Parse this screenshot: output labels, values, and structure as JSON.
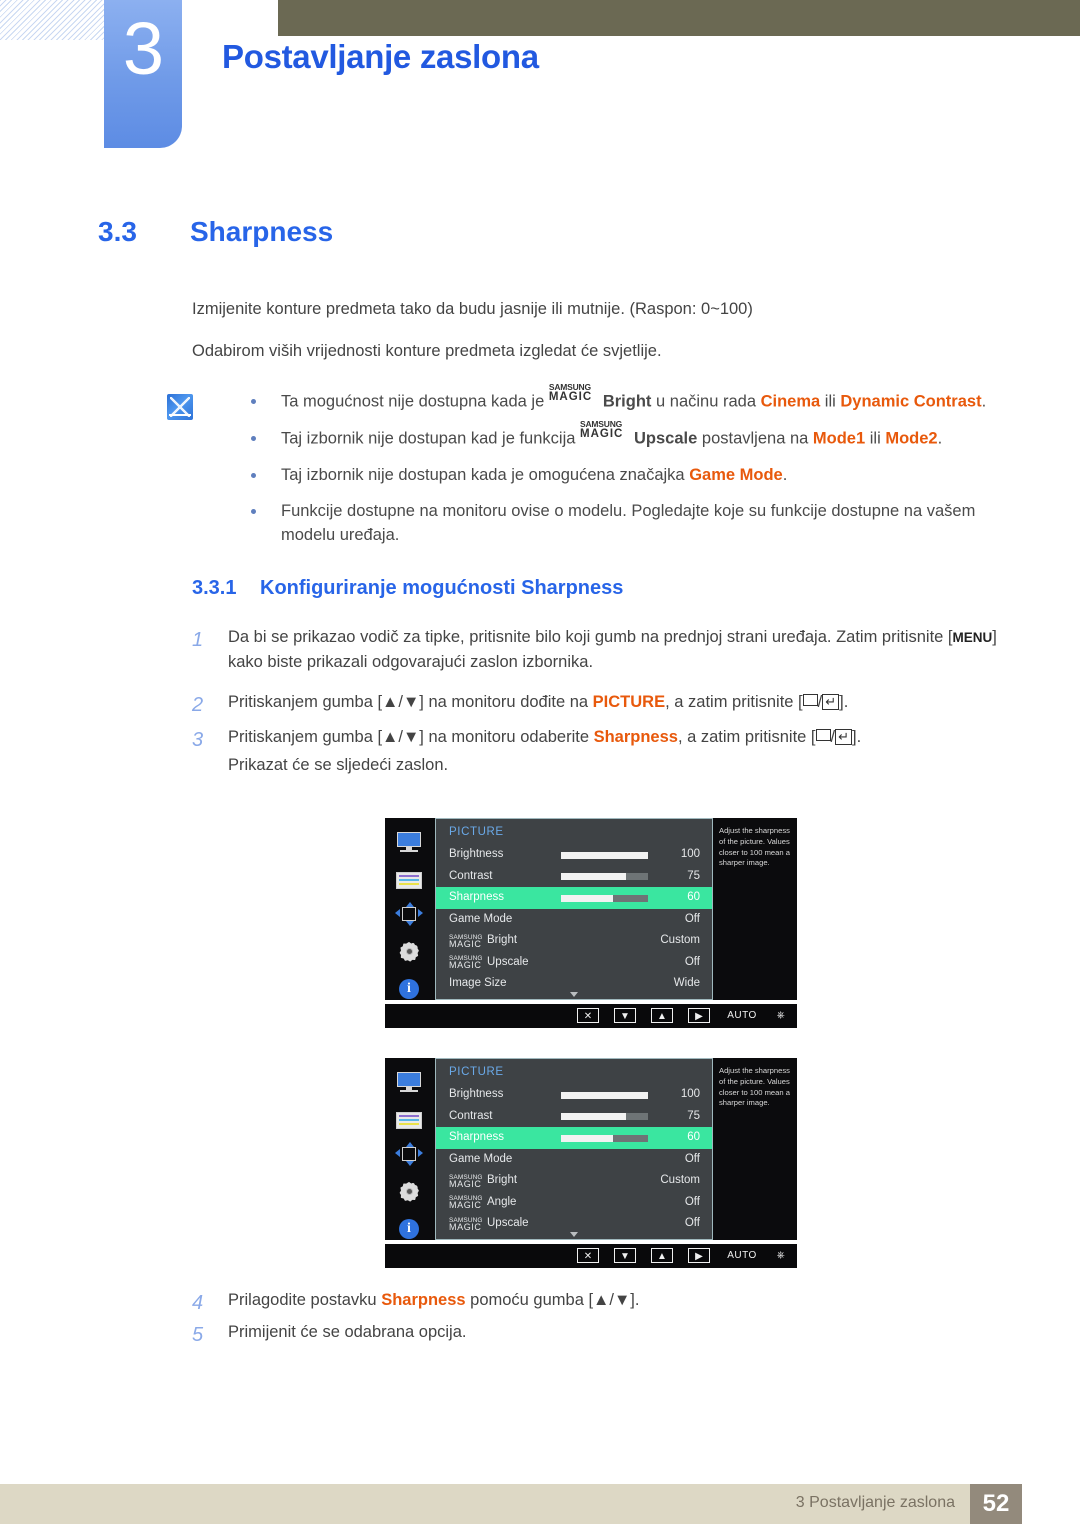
{
  "header": {
    "chapter_number": "3",
    "chapter_title": "Postavljanje zaslona"
  },
  "section": {
    "number": "3.3",
    "title": "Sharpness"
  },
  "intro": {
    "paragraph1": "Izmijenite konture predmeta tako da budu jasnije ili mutnije. (Raspon: 0~100)",
    "paragraph2": "Odabirom viših vrijednosti konture predmeta izgledat će svjetlije."
  },
  "note": {
    "icon": "note-pencil-icon",
    "bullets": [
      {
        "pre": "Ta mogućnost nije dostupna kada je ",
        "magic_top": "SAMSUNG",
        "magic_bottom": "MAGIC",
        "magic_suffix": "Bright",
        "mid": " u načinu rada ",
        "hl1": "Cinema",
        "conj": " ili ",
        "hl2": "Dynamic Contrast",
        "post": "."
      },
      {
        "pre": "Taj izbornik nije dostupan kad je funkcija ",
        "magic_top": "SAMSUNG",
        "magic_bottom": "MAGIC",
        "magic_suffix": "Upscale",
        "mid": " postavljena na ",
        "hl1": "Mode1",
        "conj": " ili ",
        "hl2": "Mode2",
        "post": "."
      },
      {
        "pre": "Taj izbornik nije dostupan kada je omogućena značajka ",
        "hl1": "Game Mode",
        "post": "."
      },
      {
        "pre": "Funkcije dostupne na monitoru ovise o modelu. Pogledajte koje su funkcije dostupne na vašem modelu uređaja."
      }
    ]
  },
  "subsection": {
    "number": "3.3.1",
    "title": "Konfiguriranje mogućnosti Sharpness"
  },
  "steps": [
    {
      "n": "1",
      "pre": "Da bi se prikazao vodič za tipke, pritisnite bilo koji gumb na prednjoj strani uređaja. Zatim pritisnite [",
      "kbd": "MENU",
      "post": "] kako biste prikazali odgovarajući zaslon izbornika."
    },
    {
      "n": "2",
      "pre": "Pritiskanjem gumba [▲/▼] na monitoru dođite na ",
      "hl": "PICTURE",
      "mid": ", a zatim pritisnite [",
      "post": "]."
    },
    {
      "n": "3",
      "pre": "Pritiskanjem gumba [▲/▼] na monitoru odaberite ",
      "hl": "Sharpness",
      "mid": ", a zatim pritisnite [",
      "post": "].",
      "extra": "Prikazat će se sljedeći zaslon."
    },
    {
      "n": "4",
      "pre": "Prilagodite postavku ",
      "hl": "Sharpness",
      "post": " pomoću gumba [▲/▼]."
    },
    {
      "n": "5",
      "pre": "Primijenit će se odabrana opcija."
    }
  ],
  "osd": {
    "menu_title": "PICTURE",
    "description": "Adjust the sharpness of the picture. Values closer to 100 mean a sharper image.",
    "sidebar_icons": [
      "monitor-icon",
      "color-bars-icon",
      "position-arrows-icon",
      "gear-icon",
      "info-icon"
    ],
    "bottom_bar": [
      "close-icon",
      "down-icon",
      "up-icon",
      "right-icon",
      "AUTO",
      "power-icon"
    ],
    "caret": "scroll-down-caret",
    "menu1": {
      "rows": [
        {
          "label": "Brightness",
          "value": "100",
          "slider": 100,
          "selected": false
        },
        {
          "label": "Contrast",
          "value": "75",
          "slider": 75,
          "selected": false
        },
        {
          "label": "Sharpness",
          "value": "60",
          "slider": 60,
          "selected": true
        },
        {
          "label": "Game Mode",
          "value": "Off",
          "selected": false
        },
        {
          "magic_top": "SAMSUNG",
          "magic_bottom": "MAGIC",
          "label": "Bright",
          "value": "Custom",
          "selected": false
        },
        {
          "magic_top": "SAMSUNG",
          "magic_bottom": "MAGIC",
          "label": "Upscale",
          "value": "Off",
          "selected": false
        },
        {
          "label": "Image Size",
          "value": "Wide",
          "selected": false
        }
      ]
    },
    "menu2": {
      "rows": [
        {
          "label": "Brightness",
          "value": "100",
          "slider": 100,
          "selected": false
        },
        {
          "label": "Contrast",
          "value": "75",
          "slider": 75,
          "selected": false
        },
        {
          "label": "Sharpness",
          "value": "60",
          "slider": 60,
          "selected": true
        },
        {
          "label": "Game Mode",
          "value": "Off",
          "selected": false
        },
        {
          "magic_top": "SAMSUNG",
          "magic_bottom": "MAGIC",
          "label": "Bright",
          "value": "Custom",
          "selected": false
        },
        {
          "magic_top": "SAMSUNG",
          "magic_bottom": "MAGIC",
          "label": "Angle",
          "value": "Off",
          "selected": false
        },
        {
          "magic_top": "SAMSUNG",
          "magic_bottom": "MAGIC",
          "label": "Upscale",
          "value": "Off",
          "selected": false
        }
      ]
    }
  },
  "footer": {
    "text": "3 Postavljanje zaslona",
    "page": "52"
  },
  "colors": {
    "accent_blue": "#2865e8",
    "olive": "#6b6953",
    "orange": "#e8590c",
    "osd_selected": "#3ae6a0",
    "footer_bar": "#ddd8c5",
    "footer_page": "#938a7c"
  }
}
